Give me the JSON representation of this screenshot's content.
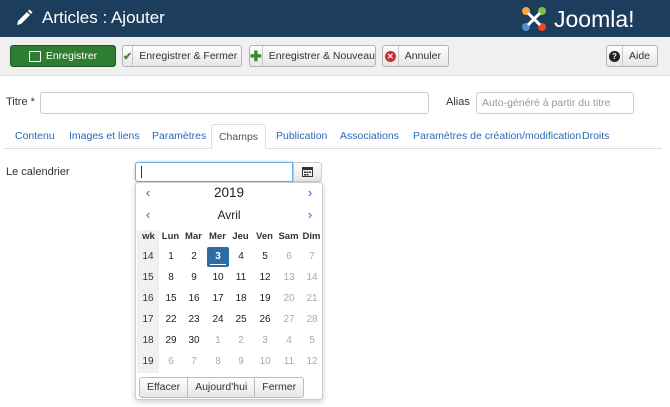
{
  "header": {
    "title": "Articles : Ajouter",
    "logo_text": "Joomla!"
  },
  "toolbar": {
    "save": "Enregistrer",
    "save_close": "Enregistrer & Fermer",
    "save_new": "Enregistrer & Nouveau",
    "cancel": "Annuler",
    "help": "Aide"
  },
  "form": {
    "title_label": "Titre *",
    "title_value": "",
    "alias_label": "Alias",
    "alias_placeholder": "Auto-généré à partir du titre"
  },
  "tabs": [
    "Contenu",
    "Images et liens",
    "Paramètres",
    "Champs",
    "Publication",
    "Associations",
    "Paramètres de création/modification",
    "Droits"
  ],
  "active_tab": "Champs",
  "calendar_field": {
    "label": "Le calendrier",
    "value": ""
  },
  "calendar": {
    "year": "2019",
    "month": "Avril",
    "prev_symbol": "‹",
    "next_symbol": "›",
    "headers": [
      "wk",
      "Lun",
      "Mar",
      "Mer",
      "Jeu",
      "Ven",
      "Sam",
      "Dim"
    ],
    "weeks": [
      {
        "wk": "14",
        "days": [
          "1",
          "2",
          "3",
          "4",
          "5",
          "6",
          "7"
        ]
      },
      {
        "wk": "15",
        "days": [
          "8",
          "9",
          "10",
          "11",
          "12",
          "13",
          "14"
        ]
      },
      {
        "wk": "16",
        "days": [
          "15",
          "16",
          "17",
          "18",
          "19",
          "20",
          "21"
        ]
      },
      {
        "wk": "17",
        "days": [
          "22",
          "23",
          "24",
          "25",
          "26",
          "27",
          "28"
        ]
      },
      {
        "wk": "18",
        "days": [
          "29",
          "30",
          "1",
          "2",
          "3",
          "4",
          "5"
        ]
      },
      {
        "wk": "19",
        "days": [
          "6",
          "7",
          "8",
          "9",
          "10",
          "11",
          "12"
        ]
      }
    ],
    "today": "3",
    "footer": {
      "clear": "Effacer",
      "today": "Aujourd'hui",
      "close": "Fermer"
    }
  },
  "colors": {
    "header_bg": "#1c3d5c",
    "save_bg": "#2f7d32",
    "link": "#2a69b8",
    "today_bg": "#2e6da4"
  }
}
